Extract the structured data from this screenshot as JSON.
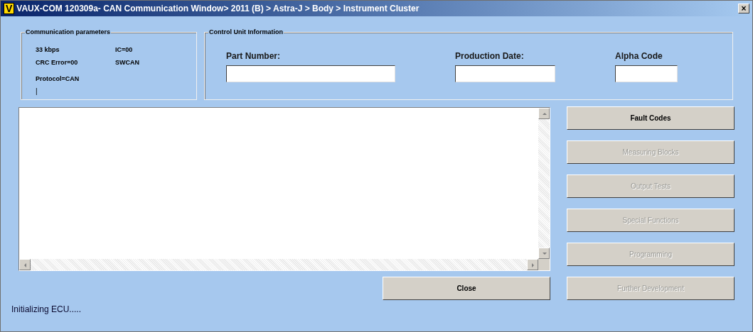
{
  "window": {
    "title": "VAUX-COM 120309a- CAN Communication Window> 2011 (B) > Astra-J > Body > Instrument Cluster",
    "logo": "V",
    "close": "×"
  },
  "communication": {
    "title": "Communication parameters",
    "items": [
      {
        "text": "33 kbps"
      },
      {
        "text": "IC=00"
      },
      {
        "text": "CRC Error=00"
      },
      {
        "text": "SWCAN"
      },
      {
        "text": "Protocol=CAN"
      }
    ],
    "cursor": "|"
  },
  "control_unit": {
    "title": "Control Unit Information",
    "fields": [
      {
        "label": "Part Number:"
      },
      {
        "label": "Production Date:"
      },
      {
        "label": "Alpha Code"
      }
    ]
  },
  "function_buttons": [
    {
      "label": "Fault Codes",
      "disabled": false
    },
    {
      "label": "Measuring Blocks",
      "disabled": true
    },
    {
      "label": "Output Tests",
      "disabled": true
    },
    {
      "label": "Special Functions",
      "disabled": true
    },
    {
      "label": "Programming",
      "disabled": true
    },
    {
      "label": "Further Development",
      "disabled": true
    }
  ],
  "close_button": {
    "label": "Close",
    "disabled": false
  },
  "status": "Initializing ECU....."
}
